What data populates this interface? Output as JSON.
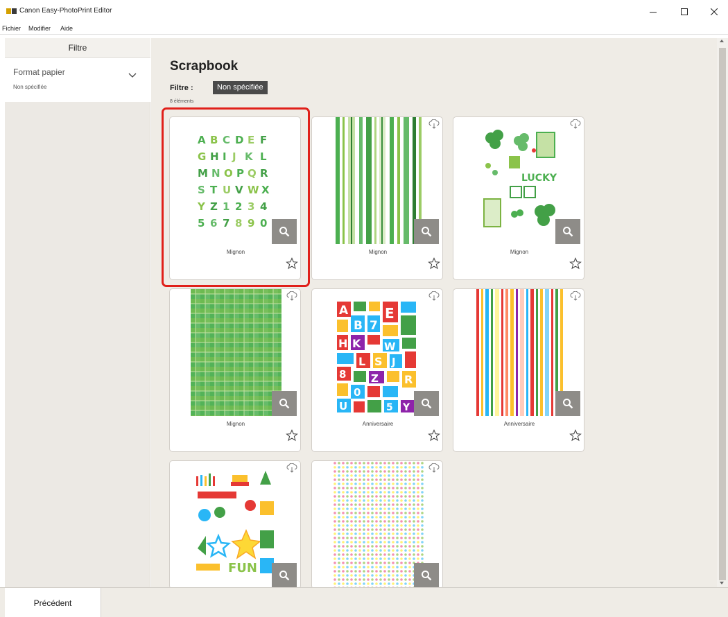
{
  "window": {
    "title": "Canon Easy-PhotoPrint Editor"
  },
  "menu": [
    "Fichier",
    "Modifier",
    "Aide"
  ],
  "sidebar": {
    "header": "Filtre",
    "filter_label": "Format papier",
    "filter_value": "Non spécifiée"
  },
  "main": {
    "title": "Scrapbook",
    "filter_label": "Filtre :",
    "filter_tag": "Non spécifiée",
    "count": "8 éléments",
    "items": [
      {
        "label": "Mignon",
        "pattern": "alphabet",
        "selected": true
      },
      {
        "label": "Mignon",
        "pattern": "green-stripes"
      },
      {
        "label": "Mignon",
        "pattern": "clover-lucky"
      },
      {
        "label": "Mignon",
        "pattern": "green-check"
      },
      {
        "label": "Anniversaire",
        "pattern": "colorful-letters"
      },
      {
        "label": "Anniversaire",
        "pattern": "rainbow-stripes"
      },
      {
        "label": "",
        "pattern": "birthday-stickers"
      },
      {
        "label": "",
        "pattern": "dots"
      }
    ]
  },
  "footer": {
    "prev_label": "Précédent"
  },
  "colors": {
    "accent": "#4a4a4a",
    "highlight": "#e0201a",
    "zoom_button": "#8e8c88",
    "panel": "#efece6"
  }
}
